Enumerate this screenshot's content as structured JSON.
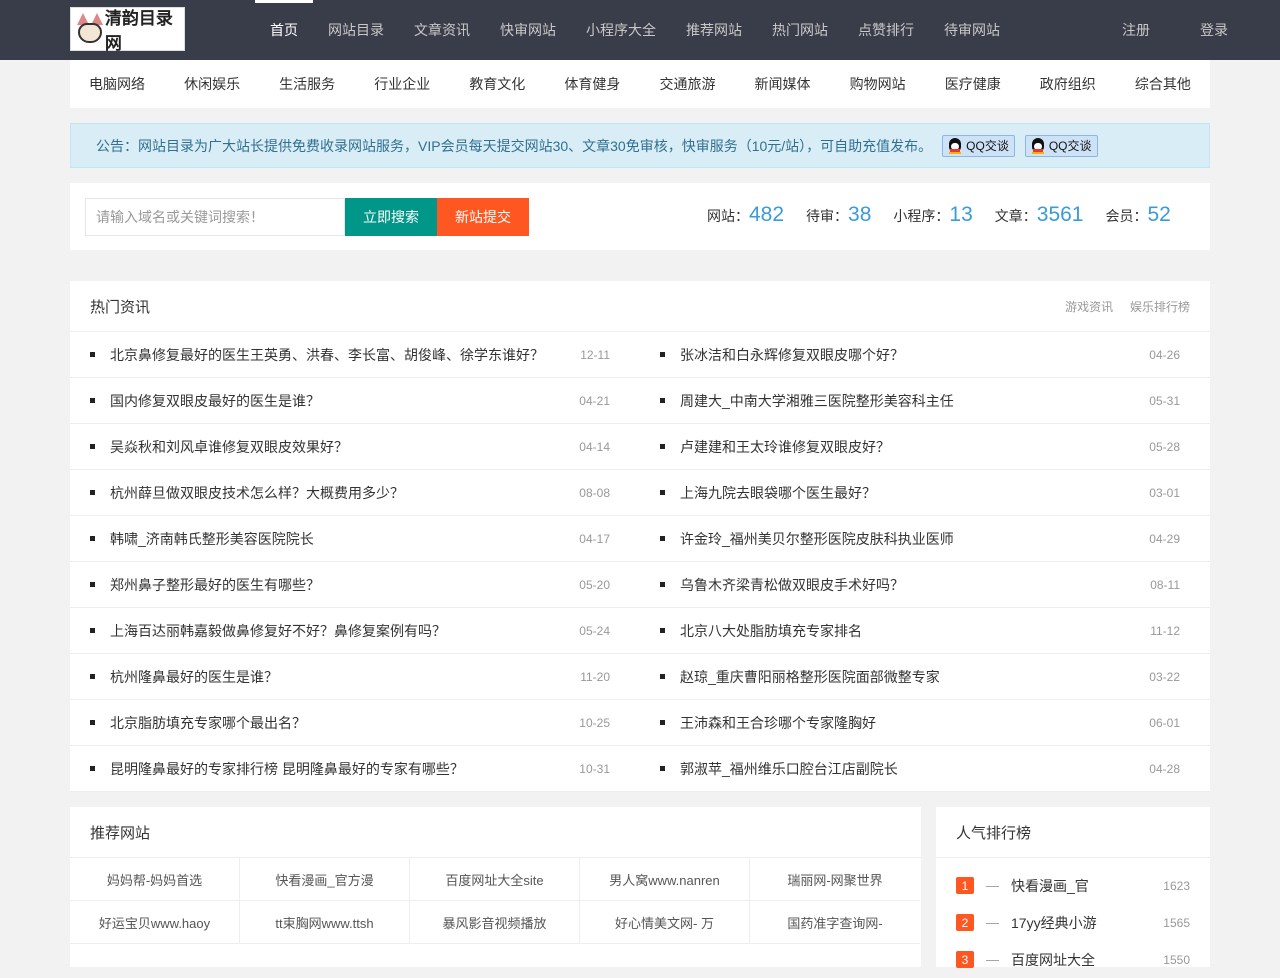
{
  "logo": {
    "text": "清韵目录网"
  },
  "nav": {
    "items": [
      "首页",
      "网站目录",
      "文章资讯",
      "快审网站",
      "小程序大全",
      "推荐网站",
      "热门网站",
      "点赞排行",
      "待审网站"
    ],
    "register": "注册",
    "login": "登录"
  },
  "categories": [
    "电脑网络",
    "休闲娱乐",
    "生活服务",
    "行业企业",
    "教育文化",
    "体育健身",
    "交通旅游",
    "新闻媒体",
    "购物网站",
    "医疗健康",
    "政府组织",
    "综合其他"
  ],
  "notice": {
    "text": "公告：网站目录为广大站长提供免费收录网站服务，VIP会员每天提交网站30、文章30免审核，快审服务（10元/站），可自助充值发布。",
    "qq1": "QQ交谈",
    "qq2": "QQ交谈"
  },
  "search": {
    "placeholder": "请输入域名或关键词搜索！",
    "search_label": "立即搜索",
    "submit_label": "新站提交"
  },
  "stats": [
    {
      "label": "网站：",
      "value": "482"
    },
    {
      "label": "待审：",
      "value": "38"
    },
    {
      "label": "小程序：",
      "value": "13"
    },
    {
      "label": "文章：",
      "value": "3561"
    },
    {
      "label": "会员：",
      "value": "52"
    }
  ],
  "hot_news": {
    "title": "热门资讯",
    "links": [
      "游戏资讯",
      "娱乐排行榜"
    ],
    "left": [
      {
        "title": "北京鼻修复最好的医生王英勇、洪春、李长富、胡俊峰、徐学东谁好？",
        "date": "12-11"
      },
      {
        "title": "国内修复双眼皮最好的医生是谁？",
        "date": "04-21"
      },
      {
        "title": "吴焱秋和刘风卓谁修复双眼皮效果好？",
        "date": "04-14"
      },
      {
        "title": "杭州薛旦做双眼皮技术怎么样？大概费用多少？",
        "date": "08-08"
      },
      {
        "title": "韩啸_济南韩氏整形美容医院院长",
        "date": "04-17"
      },
      {
        "title": "郑州鼻子整形最好的医生有哪些？",
        "date": "05-20"
      },
      {
        "title": "上海百达丽韩嘉毅做鼻修复好不好？鼻修复案例有吗？",
        "date": "05-24"
      },
      {
        "title": "杭州隆鼻最好的医生是谁？",
        "date": "11-20"
      },
      {
        "title": "北京脂肪填充专家哪个最出名？",
        "date": "10-25"
      },
      {
        "title": "昆明隆鼻最好的专家排行榜 昆明隆鼻最好的专家有哪些？",
        "date": "10-31"
      }
    ],
    "right": [
      {
        "title": "张冰洁和白永辉修复双眼皮哪个好？",
        "date": "04-26"
      },
      {
        "title": "周建大_中南大学湘雅三医院整形美容科主任",
        "date": "05-31"
      },
      {
        "title": "卢建建和王太玲谁修复双眼皮好？",
        "date": "05-28"
      },
      {
        "title": "上海九院去眼袋哪个医生最好？",
        "date": "03-01"
      },
      {
        "title": "许金玲_福州美贝尔整形医院皮肤科执业医师",
        "date": "04-29"
      },
      {
        "title": "乌鲁木齐梁青松做双眼皮手术好吗？",
        "date": "08-11"
      },
      {
        "title": "北京八大处脂肪填充专家排名",
        "date": "11-12"
      },
      {
        "title": "赵琼_重庆曹阳丽格整形医院面部微整专家",
        "date": "03-22"
      },
      {
        "title": "王沛森和王合珍哪个专家隆胸好",
        "date": "06-01"
      },
      {
        "title": "郭淑苹_福州维乐口腔台江店副院长",
        "date": "04-28"
      }
    ]
  },
  "recommend": {
    "title": "推荐网站",
    "sites": [
      "妈妈帮-妈妈首选",
      "快看漫画_官方漫",
      "百度网址大全site",
      "男人窝www.nanren",
      "瑞丽网-网聚世界",
      "好运宝贝www.haoy",
      "tt束胸网www.ttsh",
      "暴风影音视频播放",
      "好心情美文网- 万",
      "国药准字查询网-"
    ]
  },
  "rank": {
    "title": "人气排行榜",
    "items": [
      {
        "no": "1",
        "dash": "—",
        "name": "快看漫画_官",
        "count": "1623"
      },
      {
        "no": "2",
        "dash": "—",
        "name": "17yy经典小游",
        "count": "1565"
      },
      {
        "no": "3",
        "dash": "—",
        "name": "百度网址大全",
        "count": "1550"
      }
    ]
  },
  "colors": {
    "topbar": "#393d49",
    "green": "#009688",
    "orange": "#ff5722",
    "accent": "#3a9bd9"
  }
}
